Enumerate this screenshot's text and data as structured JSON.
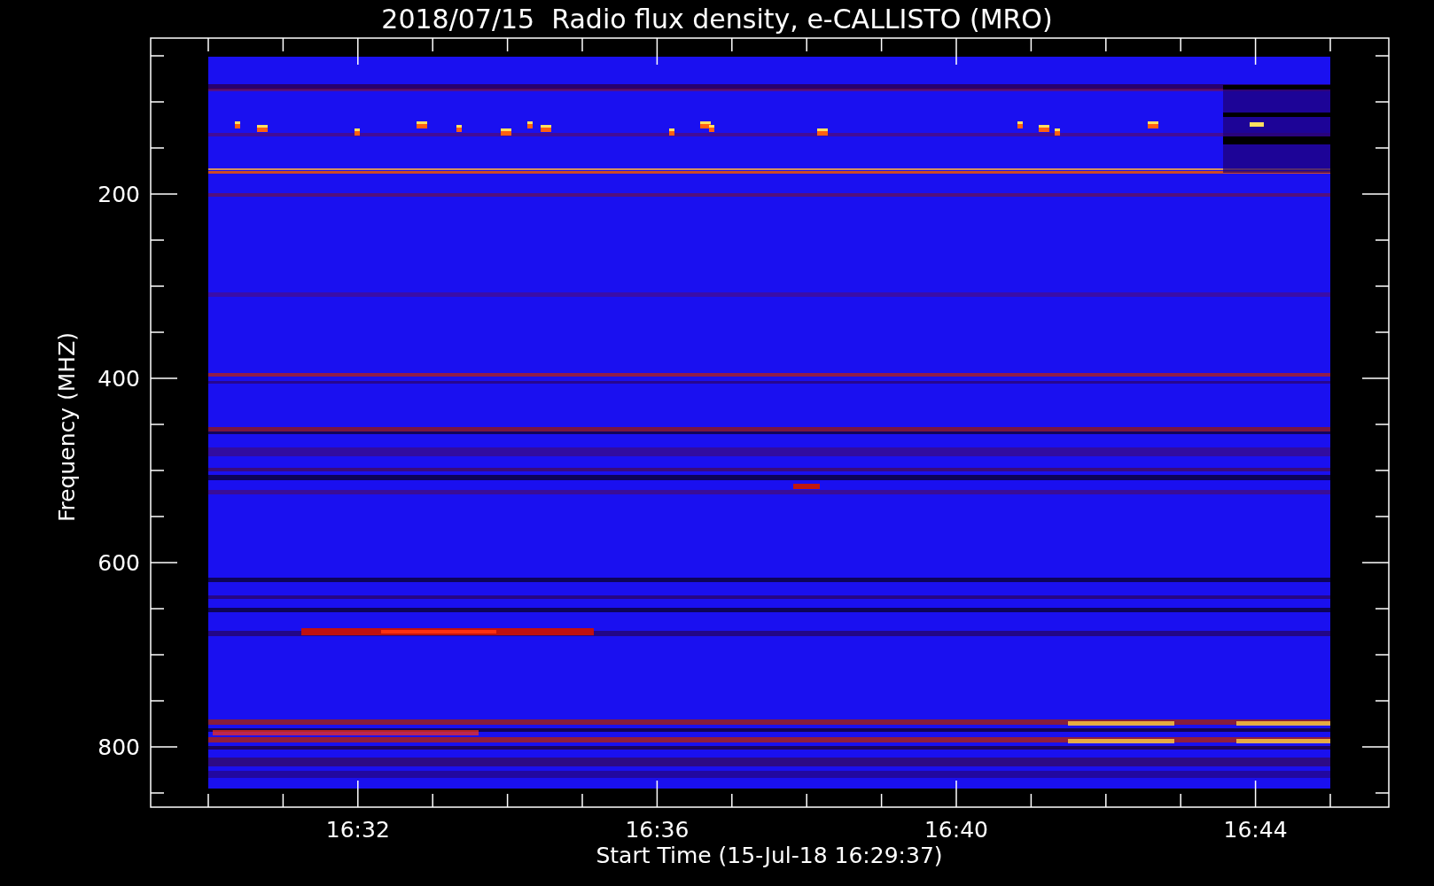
{
  "title": "2018/07/15  Radio flux density, e-CALLISTO (MRO)",
  "y_axis": {
    "label": "Frequency (MHZ)",
    "tick_labels": [
      "200",
      "400",
      "600",
      "800"
    ]
  },
  "x_axis": {
    "label": "Start Time (15-Jul-18 16:29:37)",
    "tick_labels": [
      "16:32",
      "16:36",
      "16:40",
      "16:44"
    ]
  }
}
